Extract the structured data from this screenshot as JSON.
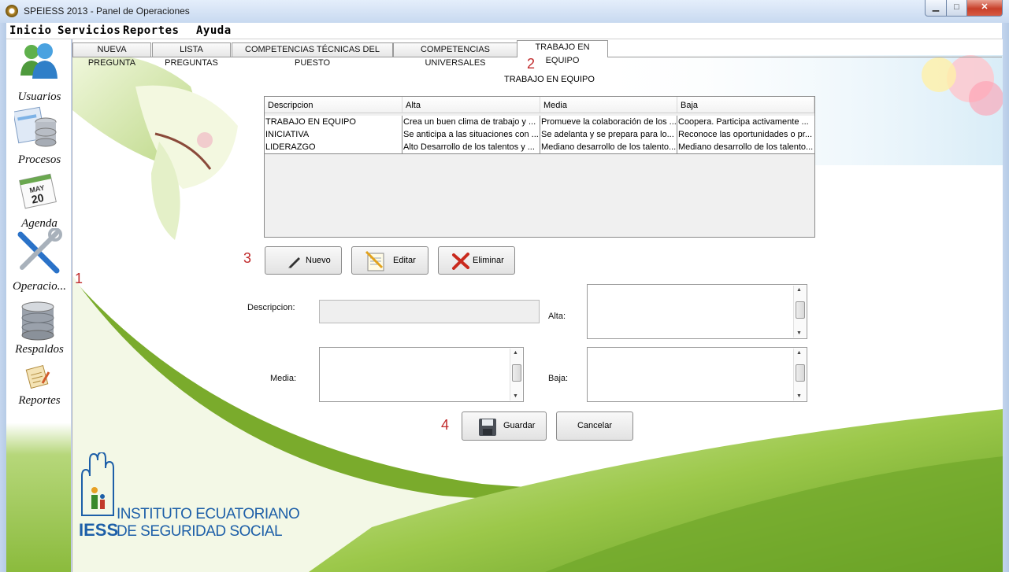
{
  "window": {
    "title": "SPEIESS 2013 - Panel de Operaciones",
    "minimize": "▁",
    "maximize": "□",
    "close": "✕"
  },
  "menu": [
    "Inicio",
    "Servicios",
    "Reportes",
    "Ayuda"
  ],
  "sidebar": [
    {
      "label": "Usuarios",
      "icon": "users-icon"
    },
    {
      "label": "Procesos",
      "icon": "database-icon"
    },
    {
      "label": "Agenda",
      "icon": "calendar-icon",
      "month": "MAY",
      "day": "20"
    },
    {
      "label": "Operacio...",
      "icon": "tools-icon"
    },
    {
      "label": "Respaldos",
      "icon": "backup-icon"
    },
    {
      "label": "Reportes",
      "icon": "report-icon"
    }
  ],
  "tabs": [
    "NUEVA PREGUNTA",
    "LISTA PREGUNTAS",
    "COMPETENCIAS TÉCNICAS DEL PUESTO",
    "COMPETENCIAS UNIVERSALES",
    "TRABAJO EN EQUIPO"
  ],
  "active_tab": "TRABAJO EN EQUIPO",
  "section_title": "TRABAJO EN EQUIPO",
  "annotations": [
    "1",
    "2",
    "3",
    "4"
  ],
  "table": {
    "columns": [
      "Descripcion",
      "Alta",
      "Media",
      "Baja"
    ],
    "rows": [
      [
        "TRABAJO EN EQUIPO",
        "Crea un buen clima de trabajo y ...",
        "Promueve la colaboración de los ...",
        "Coopera. Participa activamente ..."
      ],
      [
        "INICIATIVA",
        "Se anticipa a las situaciones con ...",
        "Se adelanta y se prepara para lo...",
        "Reconoce las oportunidades o pr..."
      ],
      [
        "LIDERAZGO",
        "Alto Desarrollo de los talentos y ...",
        "Mediano desarrollo de los talento...",
        "Mediano desarrollo de los talento..."
      ]
    ]
  },
  "buttons": {
    "nuevo": "Nuevo",
    "editar": "Editar",
    "eliminar": "Eliminar",
    "guardar": "Guardar",
    "cancelar": "Cancelar"
  },
  "form": {
    "descripcion_label": "Descripcion:",
    "descripcion_value": "",
    "alta_label": "Alta:",
    "alta_value": "",
    "media_label": "Media:",
    "media_value": "",
    "baja_label": "Baja:",
    "baja_value": ""
  },
  "logo": {
    "line1": "INSTITUTO ECUATORIANO",
    "line2": "DE SEGURIDAD SOCIAL",
    "abbr": "IESS"
  },
  "colors": {
    "accent_green": "#8bbb3d",
    "annotation_red": "#c0292a",
    "logo_blue": "#1d5fa8"
  }
}
